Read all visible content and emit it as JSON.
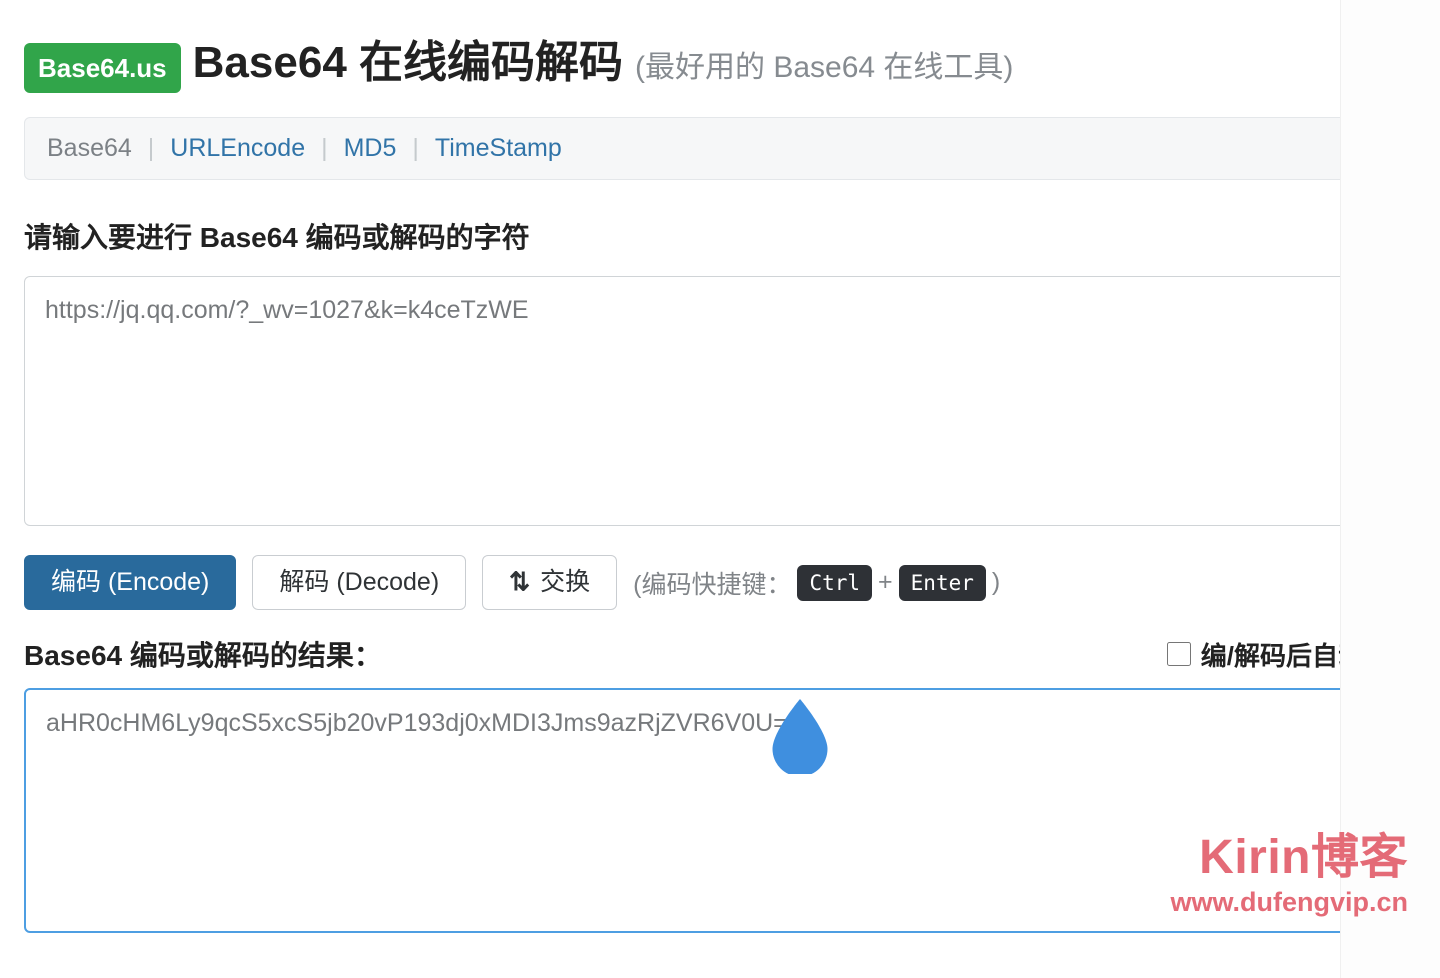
{
  "header": {
    "badge": "Base64.us",
    "title": "Base64 在线编码解码",
    "subtitle": "(最好用的 Base64 在线工具)"
  },
  "tabs": {
    "base64": "Base64",
    "urlencode": "URLEncode",
    "md5": "MD5",
    "timestamp": "TimeStamp"
  },
  "input": {
    "label": "请输入要进行 Base64 编码或解码的字符",
    "value": "https://jq.qq.com/?_wv=1027&k=k4ceTzWE"
  },
  "buttons": {
    "encode": "编码 (Encode)",
    "decode": "解码 (Decode)",
    "swap": "交换"
  },
  "shortcut": {
    "prefix": "(编码快捷键：",
    "key1": "Ctrl",
    "plus": "+",
    "key2": "Enter",
    "suffix": ")"
  },
  "output": {
    "label": "Base64 编码或解码的结果：",
    "checkbox_label": "编/解码后自动全选",
    "value": "aHR0cHM6Ly9qcS5xcS5jb20vP193dj0xMDI3Jms9azRjZVR6V0U="
  },
  "watermark": {
    "line1": "Kirin博客",
    "line2": "www.dufengvip.cn"
  }
}
